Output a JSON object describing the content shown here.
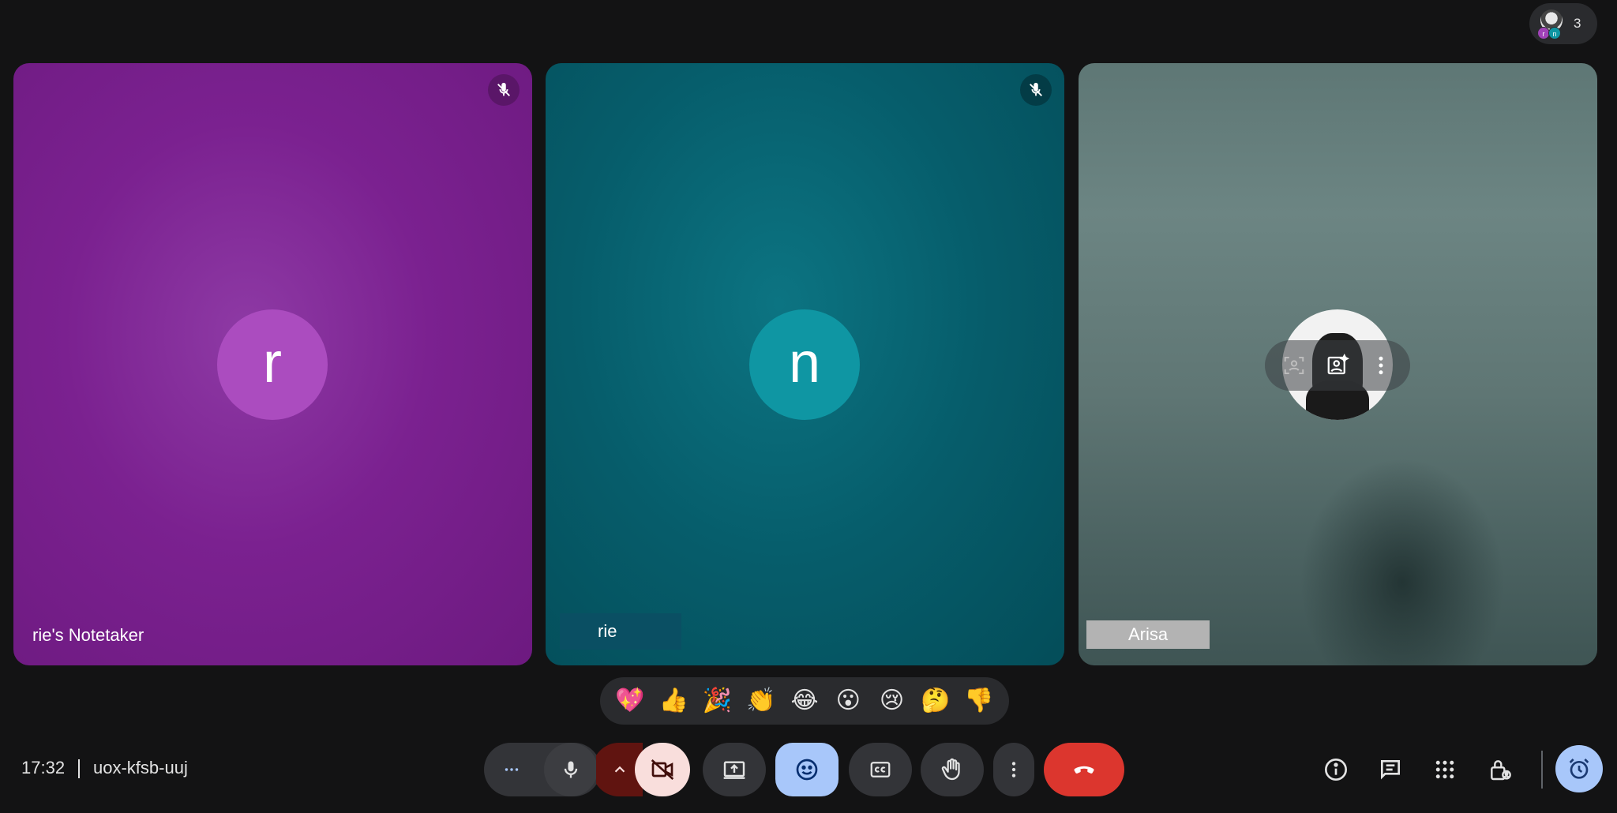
{
  "participants_count": "3",
  "tiles": [
    {
      "name": "rie's Notetaker",
      "initial": "r",
      "muted": true,
      "color": "#ab4cbf"
    },
    {
      "name": "rie",
      "initial": "n",
      "muted": true,
      "color": "#0f96a3"
    },
    {
      "name": "Arisa",
      "initial": "",
      "muted": false
    }
  ],
  "reactions": [
    "💖",
    "👍",
    "🎉",
    "👏",
    "😂",
    "😮",
    "😢",
    "🤔",
    "👎"
  ],
  "meeting": {
    "time": "17:32",
    "code": "uox-kfsb-uuj"
  },
  "colors": {
    "end_call": "#dc362e",
    "accent": "#a8c7fa",
    "cam_off": "#f9dedc"
  }
}
